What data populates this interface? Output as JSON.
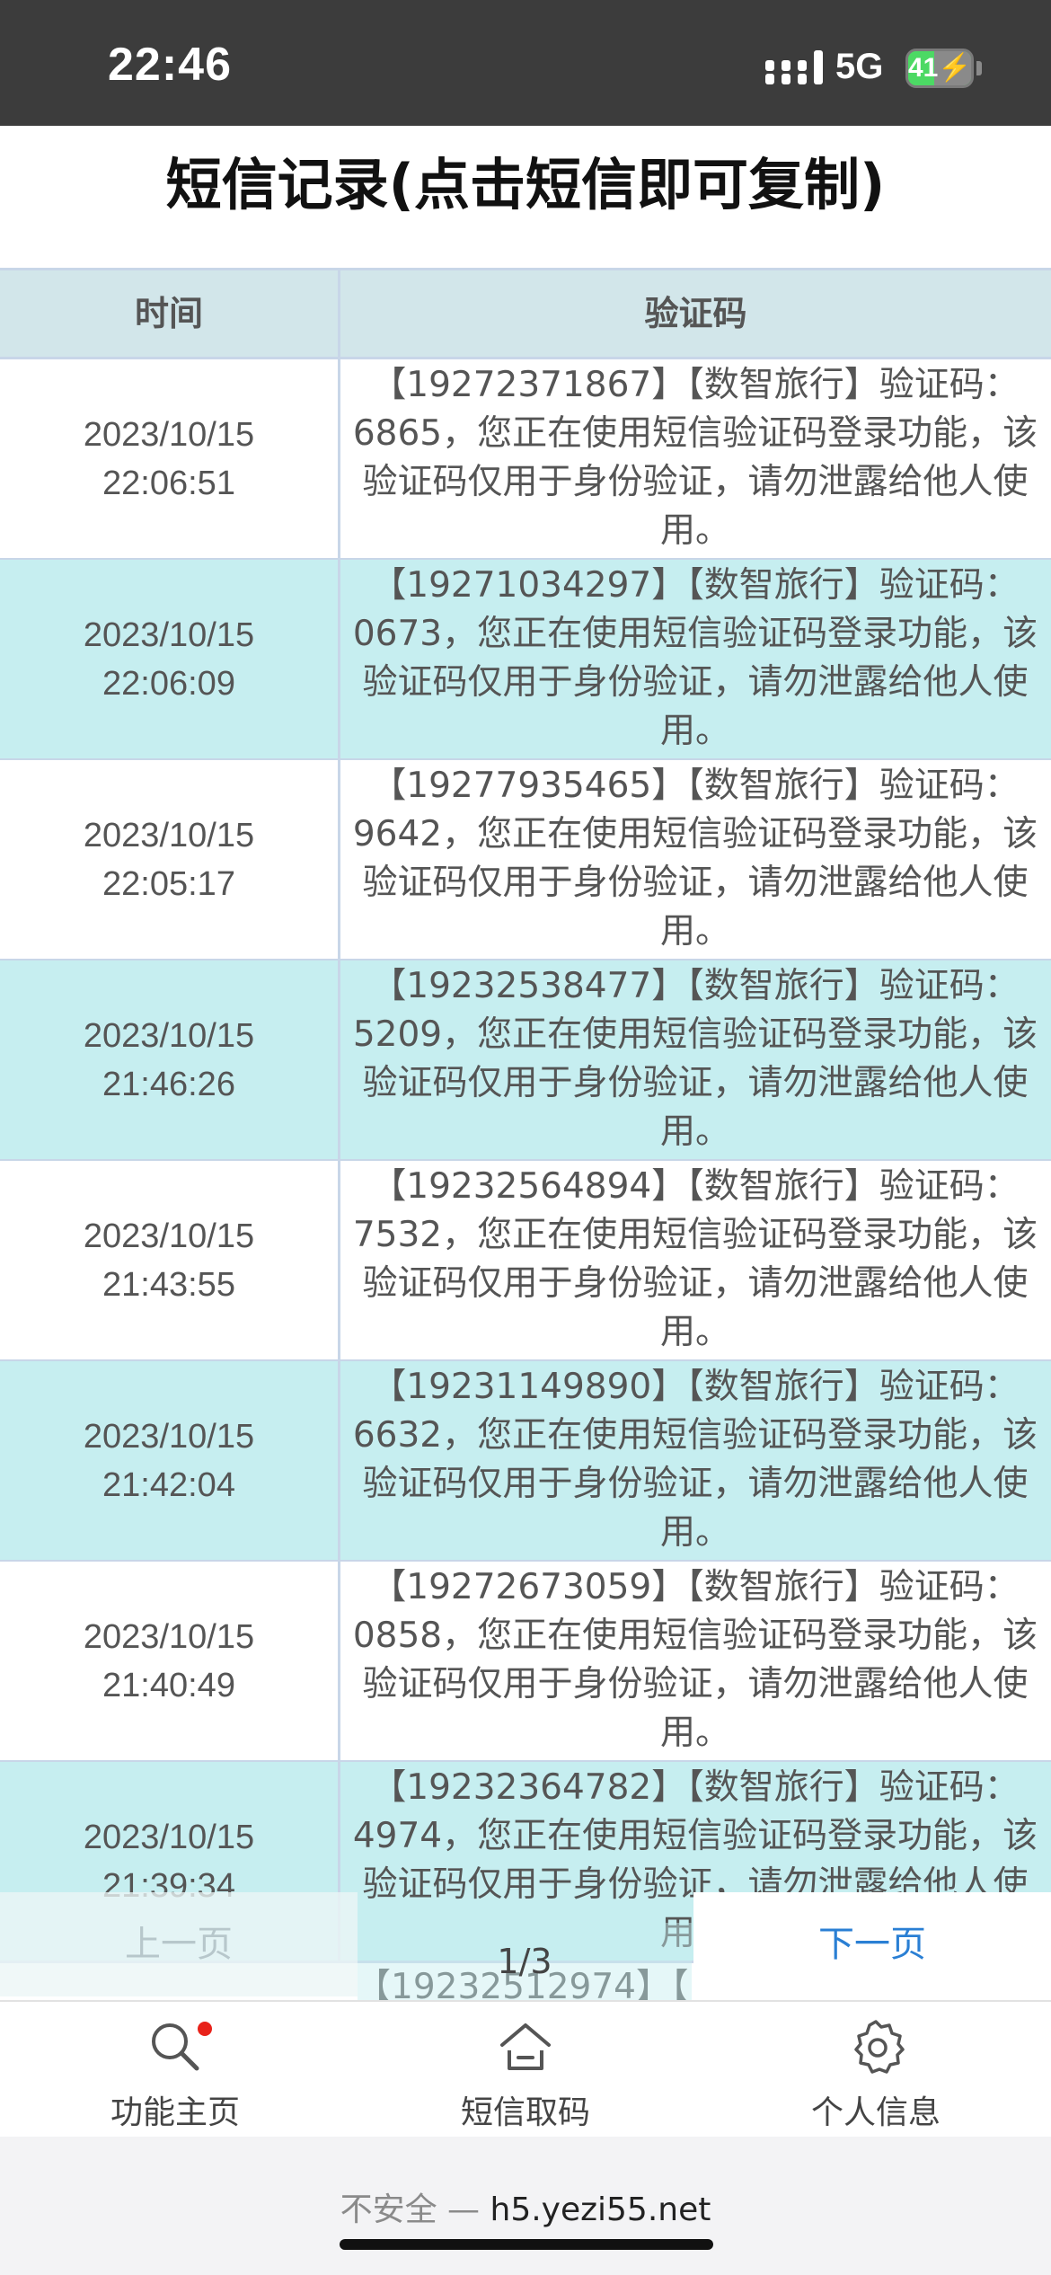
{
  "status_bar": {
    "time": "22:46",
    "network": "5G",
    "battery": "41",
    "battery_level": 0.41,
    "icons": [
      "signal-icon",
      "battery-icon",
      "charging-bolt-icon"
    ]
  },
  "page_title": "短信记录(点击短信即可复制)",
  "table": {
    "headers": {
      "time": "时间",
      "code": "验证码"
    },
    "rows": [
      {
        "date": "2023/10/15",
        "time": "22:06:51",
        "message": "【19272371867】【数智旅行】验证码：6865，您正在使用短信验证码登录功能，该验证码仅用于身份验证，请勿泄露给他人使用。"
      },
      {
        "date": "2023/10/15",
        "time": "22:06:09",
        "message": "【19271034297】【数智旅行】验证码：0673，您正在使用短信验证码登录功能，该验证码仅用于身份验证，请勿泄露给他人使用。"
      },
      {
        "date": "2023/10/15",
        "time": "22:05:17",
        "message": "【19277935465】【数智旅行】验证码：9642，您正在使用短信验证码登录功能，该验证码仅用于身份验证，请勿泄露给他人使用。"
      },
      {
        "date": "2023/10/15",
        "time": "21:46:26",
        "message": "【19232538477】【数智旅行】验证码：5209，您正在使用短信验证码登录功能，该验证码仅用于身份验证，请勿泄露给他人使用。"
      },
      {
        "date": "2023/10/15",
        "time": "21:43:55",
        "message": "【19232564894】【数智旅行】验证码：7532，您正在使用短信验证码登录功能，该验证码仅用于身份验证，请勿泄露给他人使用。"
      },
      {
        "date": "2023/10/15",
        "time": "21:42:04",
        "message": "【19231149890】【数智旅行】验证码：6632，您正在使用短信验证码登录功能，该验证码仅用于身份验证，请勿泄露给他人使用。"
      },
      {
        "date": "2023/10/15",
        "time": "21:40:49",
        "message": "【19272673059】【数智旅行】验证码：0858，您正在使用短信验证码登录功能，该验证码仅用于身份验证，请勿泄露给他人使用。"
      },
      {
        "date": "2023/10/15",
        "time": "21:39:34",
        "message": "【19232364782】【数智旅行】验证码：4974，您正在使用短信验证码登录功能，该验证码仅用于身份验证，请勿泄露给他人使用。"
      }
    ],
    "partial_row_text": "【19232512974】【"
  },
  "pagination": {
    "prev_label": "上一页",
    "indicator": "1/3",
    "next_label": "下一页"
  },
  "tabbar": {
    "items": [
      {
        "label": "功能主页",
        "icon": "search-icon",
        "badge": true
      },
      {
        "label": "短信取码",
        "icon": "home-icon",
        "badge": false
      },
      {
        "label": "个人信息",
        "icon": "gear-icon",
        "badge": false
      }
    ]
  },
  "browser": {
    "insecure_label": "不安全 —",
    "domain": "h5.yezi55.net"
  },
  "colors": {
    "status_bg": "#3c3c3c",
    "header_bg": "#d2e6ea",
    "row_alt_bg": "#c6eef0",
    "border": "#c8d6e8",
    "next_link": "#2a7fd4",
    "badge_red": "#e8221a",
    "battery_green": "#4cd964"
  }
}
